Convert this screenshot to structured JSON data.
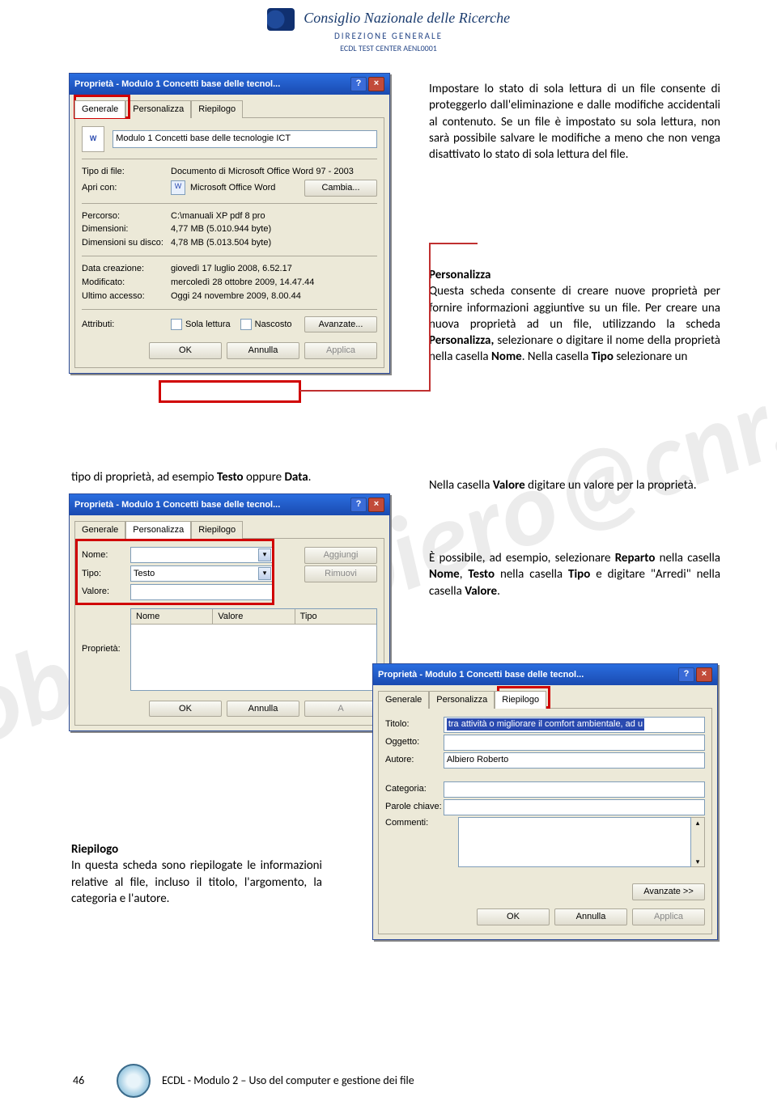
{
  "header": {
    "org": "Consiglio Nazionale delle Ricerche",
    "dir": "DIREZIONE GENERALE",
    "center": "ECDL TEST CENTER AENL0001"
  },
  "watermark": "roberto.albiero@cnr.it",
  "dlg1": {
    "title": "Proprietà - Modulo 1 Concetti base delle tecnol...",
    "tabs": [
      "Generale",
      "Personalizza",
      "Riepilogo"
    ],
    "fileTitle": "Modulo 1 Concetti base delle tecnologie ICT",
    "tipoFile_l": "Tipo di file:",
    "tipoFile_v": "Documento di Microsoft Office Word 97 - 2003",
    "apri_l": "Apri con:",
    "apri_v": "Microsoft Office Word",
    "cambia": "Cambia...",
    "percorso_l": "Percorso:",
    "percorso_v": "C:\\manuali XP pdf 8 pro",
    "dim_l": "Dimensioni:",
    "dim_v": "4,77 MB (5.010.944 byte)",
    "dim2_l": "Dimensioni su disco:",
    "dim2_v": "4,78 MB (5.013.504 byte)",
    "crea_l": "Data creazione:",
    "crea_v": "giovedì 17 luglio 2008, 6.52.17",
    "mod_l": "Modificato:",
    "mod_v": "mercoledì 28 ottobre 2009, 14.47.44",
    "acc_l": "Ultimo accesso:",
    "acc_v": "Oggi 24 novembre 2009, 8.00.44",
    "attr_l": "Attributi:",
    "sola": "Sola lettura",
    "nasc": "Nascosto",
    "avanz": "Avanzate...",
    "ok": "OK",
    "annulla": "Annulla",
    "applica": "Applica"
  },
  "dlg2": {
    "title": "Proprietà - Modulo 1 Concetti base delle tecnol...",
    "tabs": [
      "Generale",
      "Personalizza",
      "Riepilogo"
    ],
    "nome_l": "Nome:",
    "aggiungi": "Aggiungi",
    "tipo_l": "Tipo:",
    "tipo_v": "Testo",
    "rimuovi": "Rimuovi",
    "valore_l": "Valore:",
    "prop_l": "Proprietà:",
    "col1": "Nome",
    "col2": "Valore",
    "col3": "Tipo",
    "ok": "OK",
    "annulla": "Annulla",
    "applica": "A"
  },
  "dlg3": {
    "title": "Proprietà - Modulo 1 Concetti base delle tecnol...",
    "tabs": [
      "Generale",
      "Personalizza",
      "Riepilogo"
    ],
    "titolo_l": "Titolo:",
    "titolo_v": "tra attività o migliorare il comfort ambientale, ad u",
    "ogg_l": "Oggetto:",
    "aut_l": "Autore:",
    "aut_v": "Albiero Roberto",
    "cat_l": "Categoria:",
    "par_l": "Parole chiave:",
    "com_l": "Commenti:",
    "avanz": "Avanzate >>",
    "ok": "OK",
    "annulla": "Annulla",
    "applica": "Applica"
  },
  "para1": "Impostare lo stato di sola lettura di un file consente di proteggerlo dall'eliminazione e dalle modifiche accidentali al contenuto. Se un file è impostato su sola lettura, non sarà possibile salvare le modifiche a meno che non venga disattivato lo stato di sola lettura del file.",
  "para2a": "Personalizza",
  "para2": "Questa scheda consente di creare nuove proprietà per fornire informazioni aggiuntive su un file. Per creare una nuova proprietà ad un file, utilizzando la scheda ",
  "para2b": "Personalizza,",
  "para2c": " selezionare o digitare il nome della proprietà nella casella ",
  "para2d": "Nome",
  "para2e": ". Nella casella ",
  "para2f": "Tipo",
  "para2g": " selezionare un",
  "tipoOppure": "tipo di proprietà, ad esempio ",
  "testo": "Testo",
  "oppure": " oppure ",
  "data": "Data",
  "dot": ".",
  "para3a": "Nella casella ",
  "para3b": "Valore",
  "para3c": " digitare un valore per la proprietà.",
  "para4": "È possibile, ad esempio, selezionare ",
  "para4b": "Reparto",
  "para4c": " nella casella ",
  "para4d": "Nome",
  "para4e": ", ",
  "para4f": "Testo",
  "para4g": " nella casella ",
  "para4h": "Tipo",
  "para4i": " e digitare \"Arredi\" nella casella ",
  "para4j": "Valore",
  "para4k": ".",
  "riep_t": "Riepilogo",
  "riep": "In questa scheda sono riepilogate le informazioni relative al file, incluso il titolo, l'argomento, la categoria e l'autore.",
  "footer": {
    "page": "46",
    "title": "ECDL - Modulo 2 – Uso del computer e gestione dei file"
  }
}
